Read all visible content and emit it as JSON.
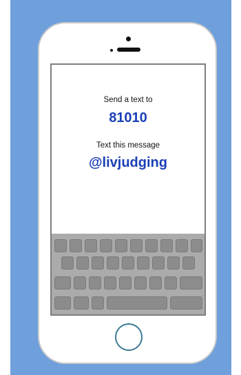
{
  "screen": {
    "line1": "Send a text to",
    "number": "81010",
    "line3": "Text this message",
    "code": "@livjudging"
  },
  "colors": {
    "background": "#6fa0dc",
    "accent_text": "#1a3fb7"
  },
  "icons": {
    "home_button": "home-button-icon",
    "camera": "camera-icon"
  }
}
